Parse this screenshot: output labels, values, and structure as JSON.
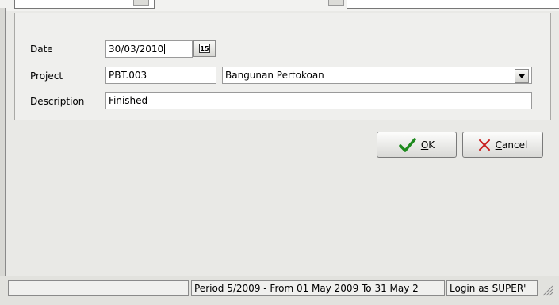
{
  "form": {
    "date_label": "Date",
    "date_value": "30/03/2010",
    "calendar_day": "15",
    "project_label": "Project",
    "project_code": "PBT.003",
    "project_name": "Bangunan Pertokoan",
    "description_label": "Description",
    "description_value": "Finished"
  },
  "buttons": {
    "ok_label": "OK",
    "ok_accel": "O",
    "ok_rest": "K",
    "cancel_label": "Cancel",
    "cancel_accel": "C",
    "cancel_rest": "ancel"
  },
  "icons": {
    "ok": "checkmark-icon",
    "cancel": "x-mark-icon",
    "calendar": "calendar-icon",
    "dropdown": "chevron-down-icon"
  },
  "colors": {
    "ok_check": "#1e8a1e",
    "cancel_x": "#c81e1e"
  },
  "status": {
    "period": "Period 5/2009 - From 01 May 2009 To 31 May 2",
    "login": "Login as SUPER'"
  }
}
